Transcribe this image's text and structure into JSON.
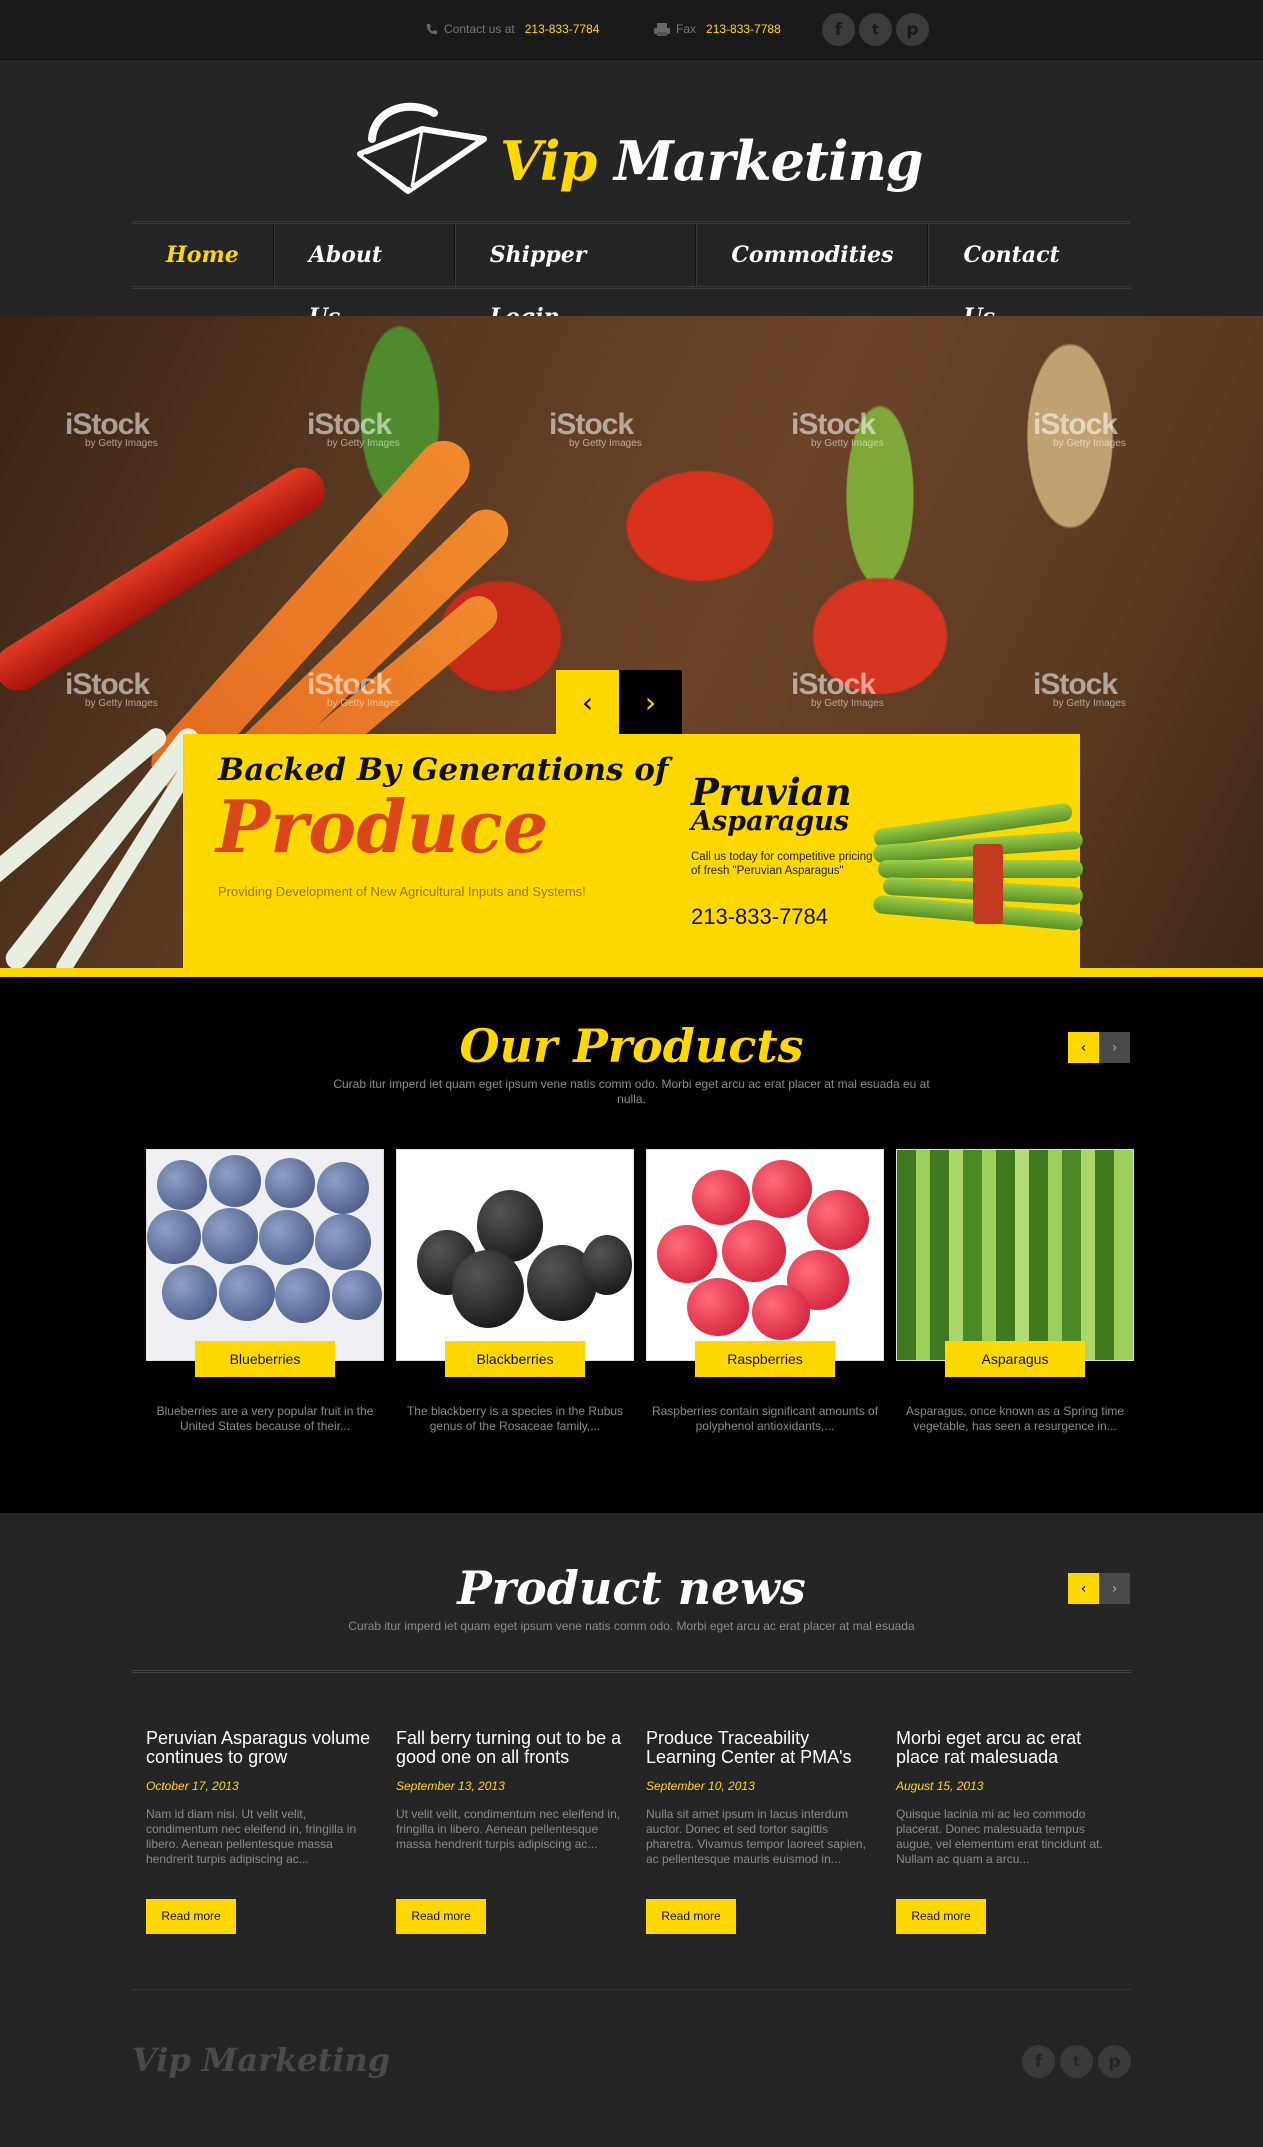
{
  "topbar": {
    "contact_label": "Contact us at",
    "contact_phone": "213-833-7784",
    "fax_label": "Fax",
    "fax_phone": "213-833-7788",
    "social": [
      "facebook-icon",
      "twitter-icon",
      "pinterest-icon"
    ]
  },
  "brand": {
    "vip": "Vip",
    "name": "Marketing",
    "footer": "Vip Marketing"
  },
  "nav": [
    {
      "label": "Home",
      "active": true
    },
    {
      "label": "About Us"
    },
    {
      "label": "Shipper Login"
    },
    {
      "label": "Commodities"
    },
    {
      "label": "Contact Us"
    }
  ],
  "hero": {
    "headline": "Backed By Generations of",
    "headline_big": "Produce",
    "subline": "Providing Development of New Agricultural Inputs and Systems!",
    "promo_title1": "Pruvian",
    "promo_title2": "Asparagus",
    "promo_desc": "Call us today for competitive pricing of fresh \"Peruvian Asparagus\"",
    "promo_phone": "213-833-7784",
    "watermark": "iStock",
    "watermark_sub": "by Getty Images"
  },
  "products": {
    "title": "Our Products",
    "subtitle": "Curab itur imperd iet quam eget ipsum vene natis comm odo. Morbi eget arcu ac erat placer at mal esuada eu at nulla.",
    "items": [
      {
        "name": "Blueberries",
        "desc": "Blueberries are a very popular fruit in the United States because of their..."
      },
      {
        "name": "Blackberries",
        "desc": "The blackberry is a species in the Rubus genus of the Rosaceae family,..."
      },
      {
        "name": "Raspberries",
        "desc": "Raspberries contain significant amounts of polyphenol antioxidants,..."
      },
      {
        "name": "Asparagus",
        "desc": "Asparagus, once known as a Spring time vegetable, has seen a resurgence in..."
      }
    ]
  },
  "news": {
    "title": "Product news",
    "subtitle": "Curab itur imperd iet quam eget ipsum vene natis comm odo. Morbi eget arcu ac erat placer at mal esuada",
    "read_more": "Read more",
    "items": [
      {
        "title": "Peruvian Asparagus volume continues to grow",
        "date": "October 17, 2013",
        "text": "Nam id diam nisi. Ut velit velit, condimentum nec eleifend in, fringilla in libero. Aenean pellentesque massa hendrerit turpis adipiscing ac..."
      },
      {
        "title": "Fall berry turning out to be a good one on all fronts",
        "date": "September 13, 2013",
        "text": "Ut velit velit, condimentum nec eleifend in, fringilla in libero. Aenean pellentesque massa hendrerit turpis adipiscing ac..."
      },
      {
        "title": "Produce Traceability Learning Center at PMA's",
        "date": "September 10, 2013",
        "text": "Nulla sit amet ipsum in lacus interdum auctor. Donec et sed tortor sagittis pharetra. Vivamus tempor laoreet sapien, ac pellentesque mauris euismod in..."
      },
      {
        "title": "Morbi eget arcu ac erat place rat malesuada",
        "date": "August 15, 2013",
        "text": "Quisque lacinia mi ac leo commodo placerat. Donec malesuada tempus augue, vel elementum erat tincidunt at. Nullam ac quam a arcu..."
      }
    ]
  },
  "colors": {
    "accent": "#ffd800",
    "dark": "#000000",
    "panel": "#252525",
    "produce": "#d9471b"
  }
}
